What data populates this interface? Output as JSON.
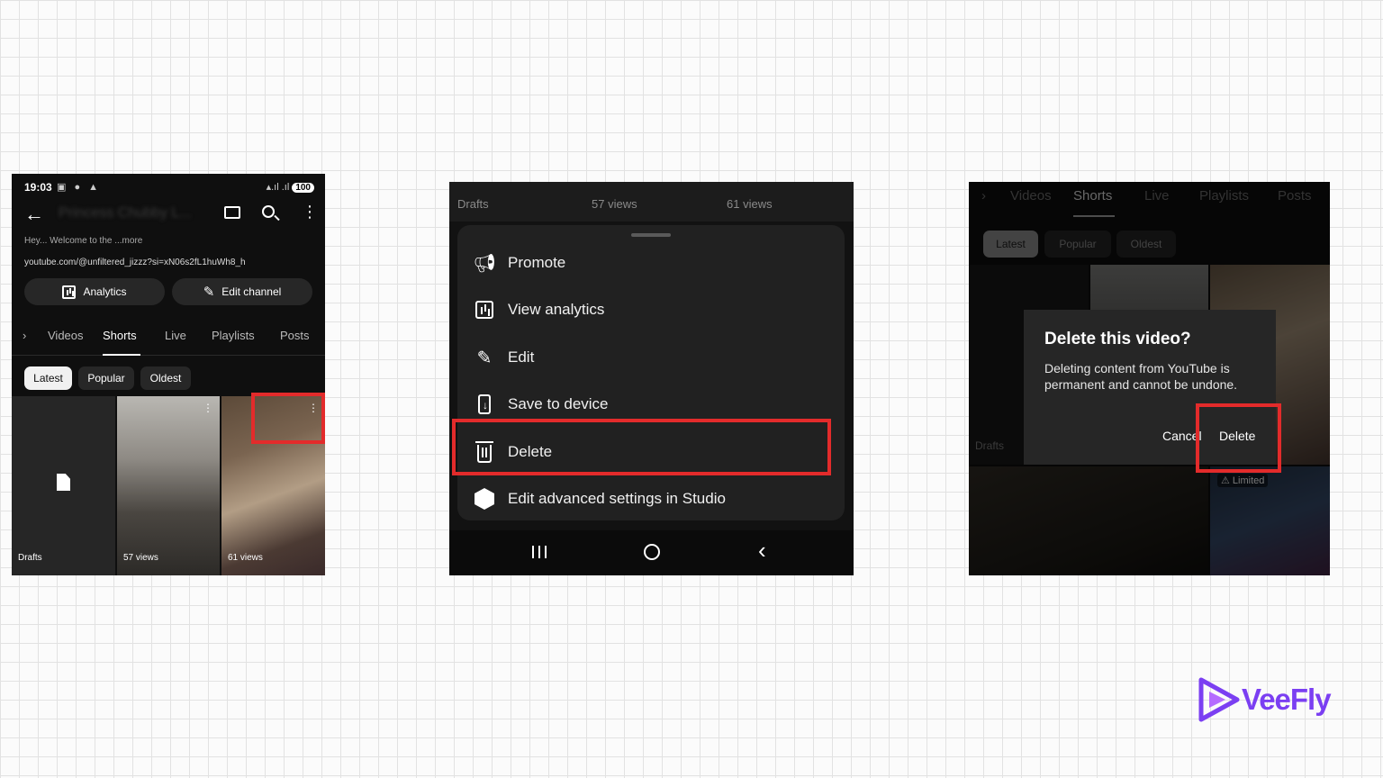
{
  "panel1": {
    "status": {
      "time": "19:03",
      "battery": "100"
    },
    "channel_name": "Princess Chubby L...",
    "description": "Hey... Welcome to the ...more",
    "url": "youtube.com/@unfiltered_jizzz?si=xN06s2fL1huWh8_h",
    "buttons": {
      "analytics": "Analytics",
      "edit_channel": "Edit channel"
    },
    "tabs": [
      {
        "label": "›",
        "active": false
      },
      {
        "label": "Videos",
        "active": false
      },
      {
        "label": "Shorts",
        "active": true
      },
      {
        "label": "Live",
        "active": false
      },
      {
        "label": "Playlists",
        "active": false
      },
      {
        "label": "Posts",
        "active": false
      }
    ],
    "chips": [
      {
        "label": "Latest",
        "active": true
      },
      {
        "label": "Popular",
        "active": false
      },
      {
        "label": "Oldest",
        "active": false
      }
    ],
    "thumbs": [
      {
        "label": "Drafts"
      },
      {
        "label": "57 views"
      },
      {
        "label": "61 views"
      }
    ]
  },
  "panel2": {
    "strip": [
      "Drafts",
      "57 views",
      "61 views"
    ],
    "menu": [
      {
        "label": "Promote",
        "icon": "megaphone-icon"
      },
      {
        "label": "View analytics",
        "icon": "analytics-icon"
      },
      {
        "label": "Edit",
        "icon": "pencil-icon"
      },
      {
        "label": "Save to device",
        "icon": "save-to-device-icon"
      },
      {
        "label": "Delete",
        "icon": "trash-icon"
      },
      {
        "label": "Edit advanced settings in Studio",
        "icon": "studio-hexagon-icon"
      }
    ]
  },
  "panel3": {
    "tabs": [
      {
        "label": "›",
        "active": false
      },
      {
        "label": "Videos",
        "active": false
      },
      {
        "label": "Shorts",
        "active": true
      },
      {
        "label": "Live",
        "active": false
      },
      {
        "label": "Playlists",
        "active": false
      },
      {
        "label": "Posts",
        "active": false
      }
    ],
    "chips": [
      {
        "label": "Latest",
        "active": true
      },
      {
        "label": "Popular",
        "active": false
      },
      {
        "label": "Oldest",
        "active": false
      }
    ],
    "drafts_label": "Drafts",
    "limited_badge": "Limited",
    "dialog": {
      "title": "Delete this video?",
      "body": "Deleting content from YouTube is permanent and cannot be undone.",
      "cancel": "Cancel",
      "delete": "Delete"
    }
  },
  "logo": {
    "text": "VeeFly"
  },
  "colors": {
    "highlight": "#e32b2b",
    "app_bg": "#0f0f0f",
    "sheet_bg": "#212121",
    "dialog_bg": "#262626",
    "logo": "#7b3ff2"
  }
}
